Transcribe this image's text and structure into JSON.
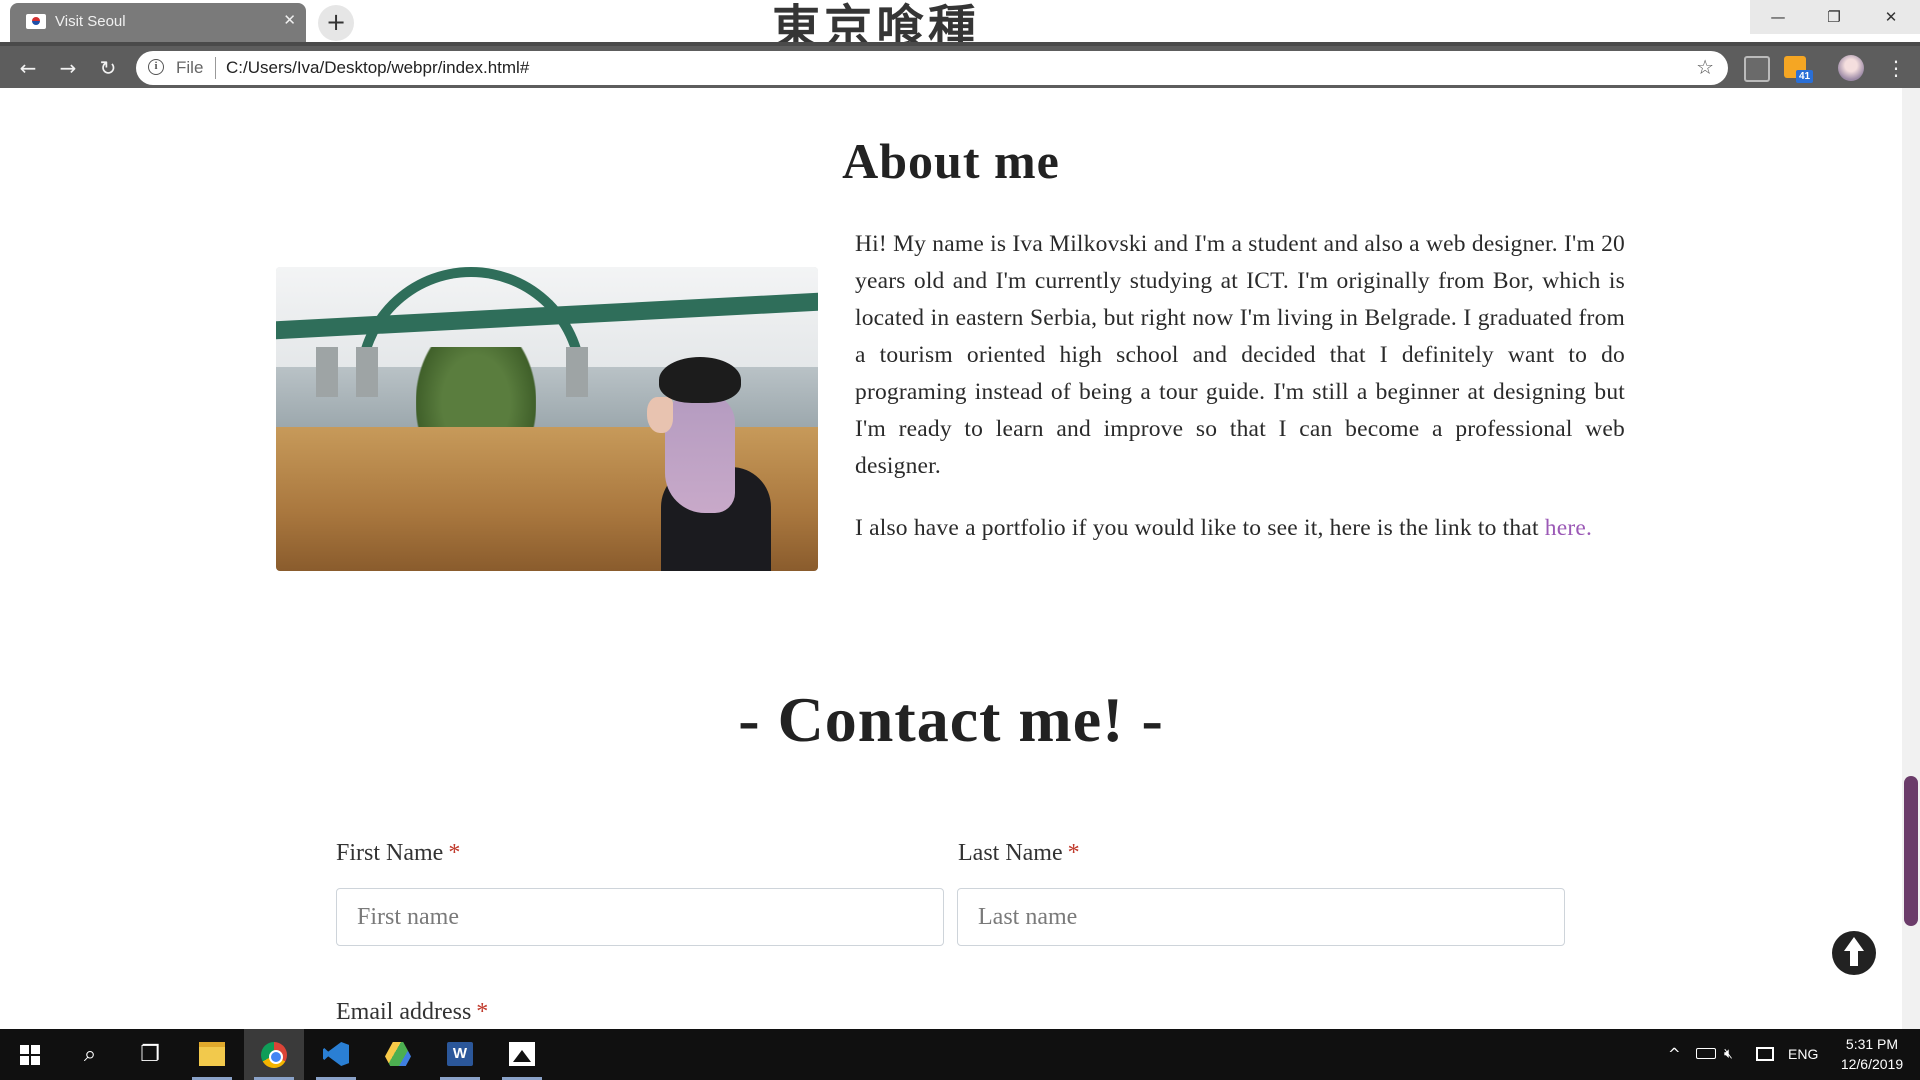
{
  "browser": {
    "tab_title": "Visit Seoul",
    "tab_close": "✕",
    "new_tab": "+",
    "omnibox": {
      "scheme_label": "File",
      "url": "C:/Users/Iva/Desktop/webpr/index.html#"
    },
    "extension_badge": "41",
    "window_controls": {
      "minimize": "—",
      "maximize": "❐",
      "close": "✕"
    },
    "nav": {
      "back": "←",
      "forward": "→",
      "reload": "↻",
      "star": "☆",
      "menu": "⋮"
    }
  },
  "about": {
    "title": "About me",
    "paragraph1": "Hi! My name is Iva Milkovski and I'm a student and also a web designer. I'm 20 years old and I'm currently studying at ICT. I'm originally from Bor, which is located in eastern Serbia, but right now I'm living in Belgrade. I graduated from a tourism oriented high school and decided that I definitely want to do programing instead of being a tour guide. I'm still a beginner at designing but I'm ready to learn and improve so that I can become a professional web designer.",
    "paragraph2_text": "I also have a portfolio if you would like to see it, here is the link to that",
    "portfolio_link": "here.",
    "photo_alt": "Photo of Iva by the river with a bridge in Belgrade"
  },
  "contact": {
    "title": "- Contact me! -",
    "first_name_label": "First Name",
    "first_name_placeholder": "First name",
    "last_name_label": "Last Name",
    "last_name_placeholder": "Last name",
    "email_label": "Email address",
    "required_mark": "*"
  },
  "taskbar": {
    "language": "ENG",
    "time": "5:31 PM",
    "date": "12/6/2019",
    "tray_chevron": "^",
    "volume": "🔇︎"
  },
  "icons": {
    "back": "arrow-left-icon",
    "forward": "arrow-right-icon",
    "reload": "reload-icon",
    "info": "info-icon",
    "star": "star-icon",
    "scroll_top": "arrow-up-circle-icon"
  },
  "colors": {
    "link": "#9b59b6",
    "required": "#c0392b",
    "scroll_thumb": "#6b3c6a",
    "toolbar": "#5d5d5d"
  }
}
